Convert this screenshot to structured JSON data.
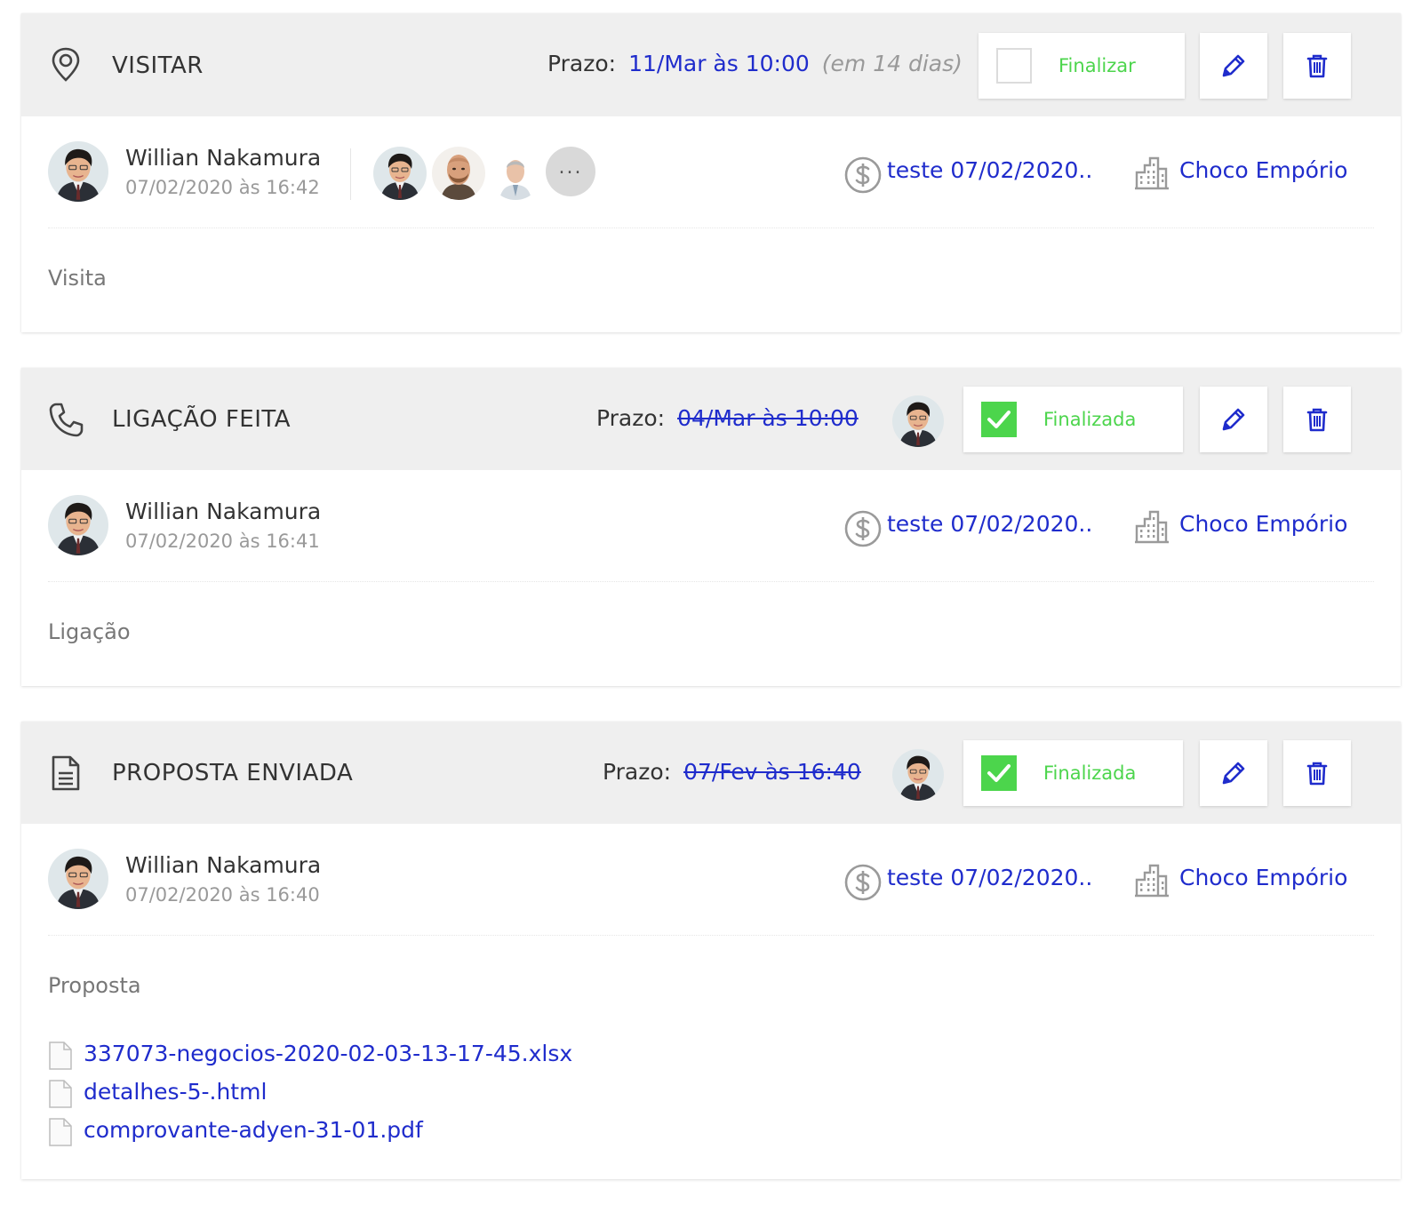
{
  "tasks": [
    {
      "type": "VISITAR",
      "type_icon": "map-pin-icon",
      "prazo_label": "Prazo:",
      "prazo_date": "11/Mar às 10:00",
      "prazo_relative": "(em 14 dias)",
      "finished": false,
      "finish_label": "Finalizar",
      "author": "Willian Nakamura",
      "created": "07/02/2020 às 16:42",
      "participants_more": "...",
      "deal": "teste 07/02/2020..",
      "company": "Choco Empório",
      "description": "Visita"
    },
    {
      "type": "LIGAÇÃO FEITA",
      "type_icon": "phone-icon",
      "prazo_label": "Prazo:",
      "prazo_date": "04/Mar às 10:00",
      "finished": true,
      "finish_label": "Finalizada",
      "author": "Willian Nakamura",
      "created": "07/02/2020 às 16:41",
      "deal": "teste 07/02/2020..",
      "company": "Choco Empório",
      "description": "Ligação"
    },
    {
      "type": "PROPOSTA ENVIADA",
      "type_icon": "document-icon",
      "prazo_label": "Prazo:",
      "prazo_date": "07/Fev às 16:40",
      "finished": true,
      "finish_label": "Finalizada",
      "author": "Willian Nakamura",
      "created": "07/02/2020 às 16:40",
      "deal": "teste 07/02/2020..",
      "company": "Choco Empório",
      "description": "Proposta",
      "files": [
        "337073-negocios-2020-02-03-13-17-45.xlsx",
        "detalhes-5-.html",
        "comprovante-adyen-31-01.pdf"
      ]
    }
  ],
  "colors": {
    "link": "#1f2ccc",
    "finished_green": "#4cd54c",
    "header_bg": "#efefef"
  }
}
